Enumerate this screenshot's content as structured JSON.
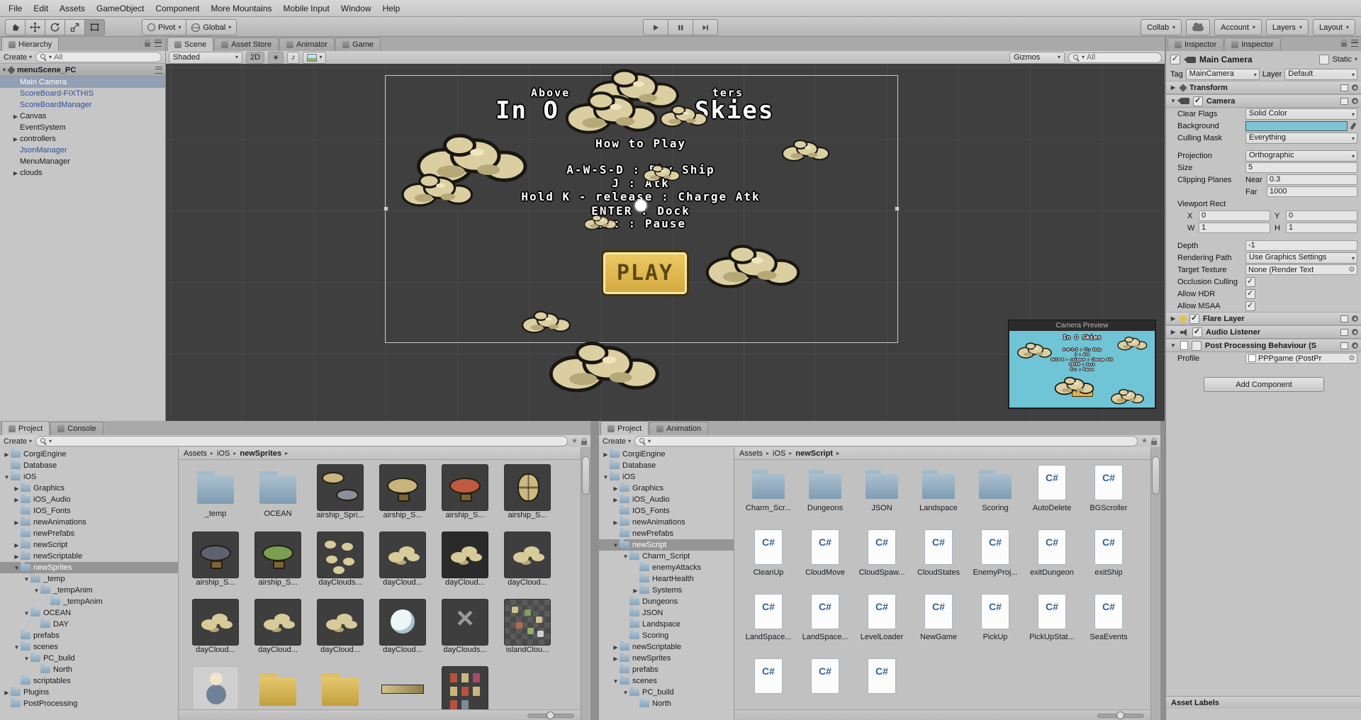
{
  "menu": {
    "items": [
      "File",
      "Edit",
      "Assets",
      "GameObject",
      "Component",
      "More Mountains",
      "Mobile Input",
      "Window",
      "Help"
    ]
  },
  "toolbar": {
    "pivot": "Pivot",
    "global": "Global",
    "collab": "Collab",
    "account": "Account",
    "layers": "Layers",
    "layout": "Layout"
  },
  "hierarchy": {
    "tab": "Hierarchy",
    "create_label": "Create",
    "search_filter": "All",
    "scene_name": "menuScene_PC",
    "items": [
      {
        "label": "Main Camera",
        "cls": "selected",
        "indent": 1
      },
      {
        "label": "ScoreBoard-FIXTHIS",
        "cls": "prefab",
        "indent": 1
      },
      {
        "label": "ScoreBoardManager",
        "cls": "prefab",
        "indent": 1
      },
      {
        "label": "Canvas",
        "arrow": "▶",
        "indent": 1
      },
      {
        "label": "EventSystem",
        "indent": 1
      },
      {
        "label": "controllers",
        "arrow": "▶",
        "indent": 1
      },
      {
        "label": "JsonManager",
        "cls": "prefab",
        "indent": 1
      },
      {
        "label": "MenuManager",
        "indent": 1
      },
      {
        "label": "clouds",
        "arrow": "▶",
        "indent": 1
      }
    ]
  },
  "scene": {
    "tabs": [
      "Scene",
      "Asset Store",
      "Animator",
      "Game"
    ],
    "shaded": "Shaded",
    "mode2d": "2D",
    "gizmos": "Gizmos",
    "search_filter": "All",
    "overlay": {
      "subtitle_left": "Above",
      "subtitle_right": "ters",
      "title_left": "In O",
      "title_right": "Skies",
      "howto": "How to Play",
      "line1": "A-W-S-D : Fly Ship",
      "line2": "J : Atk",
      "line3": "Hold K - release : Charge Atk",
      "line4": "ENTER : Dock",
      "line5": "Esc : Pause",
      "play_label": "PLAY"
    },
    "camera_preview_label": "Camera Preview"
  },
  "inspector": {
    "tabs": [
      "Inspector",
      "Inspector"
    ],
    "name": "Main Camera",
    "static_label": "Static",
    "tag_label": "Tag",
    "tag_value": "MainCamera",
    "layer_label": "Layer",
    "layer_value": "Default",
    "transform_title": "Transform",
    "camera_title": "Camera",
    "rows": {
      "clear_flags_label": "Clear Flags",
      "clear_flags": "Solid Color",
      "background_label": "Background",
      "culling_label": "Culling Mask",
      "culling": "Everything",
      "projection_label": "Projection",
      "projection": "Orthographic",
      "size_label": "Size",
      "size": "5",
      "clipping_label": "Clipping Planes",
      "near_label": "Near",
      "near": "0.3",
      "far_label": "Far",
      "far": "1000",
      "viewport_label": "Viewport Rect",
      "x_label": "X",
      "x": "0",
      "y_label": "Y",
      "y": "0",
      "w_label": "W",
      "w": "1",
      "h_label": "H",
      "h": "1",
      "depth_label": "Depth",
      "depth": "-1",
      "rendering_label": "Rendering Path",
      "rendering": "Use Graphics Settings",
      "target_label": "Target Texture",
      "target": "None (Render Text",
      "occlusion_label": "Occlusion Culling",
      "hdr_label": "Allow HDR",
      "msaa_label": "Allow MSAA"
    },
    "flare_title": "Flare Layer",
    "audio_title": "Audio Listener",
    "ppb_title": "Post Processing Behaviour (S",
    "profile_label": "Profile",
    "profile_value": "PPPgame (PostPr",
    "add_component": "Add Component",
    "asset_labels": "Asset Labels"
  },
  "project1": {
    "tabs": [
      "Project",
      "Console"
    ],
    "create_label": "Create",
    "breadcrumb": [
      "Assets",
      "iOS",
      "newSprites"
    ],
    "tree": [
      {
        "label": "CorgiEngine",
        "arrow": "▶",
        "indent": 0
      },
      {
        "label": "Database",
        "indent": 0
      },
      {
        "label": "iOS",
        "arrow": "▼",
        "indent": 0
      },
      {
        "label": "Graphics",
        "arrow": "▶",
        "indent": 1
      },
      {
        "label": "iOS_Audio",
        "arrow": "▶",
        "indent": 1
      },
      {
        "label": "IOS_Fonts",
        "indent": 1
      },
      {
        "label": "newAnimations",
        "arrow": "▶",
        "indent": 1
      },
      {
        "label": "newPrefabs",
        "indent": 1
      },
      {
        "label": "newScript",
        "arrow": "▶",
        "indent": 1
      },
      {
        "label": "newScriptable",
        "arrow": "▶",
        "indent": 1
      },
      {
        "label": "newSprites",
        "arrow": "▼",
        "indent": 1,
        "cls": "selected"
      },
      {
        "label": "_temp",
        "arrow": "▼",
        "indent": 2
      },
      {
        "label": "_tempAnim",
        "arrow": "▼",
        "indent": 3
      },
      {
        "label": "_tempAnim",
        "indent": 4
      },
      {
        "label": "OCEAN",
        "arrow": "▼",
        "indent": 2
      },
      {
        "label": "DAY",
        "indent": 3
      },
      {
        "label": "prefabs",
        "indent": 1
      },
      {
        "label": "scenes",
        "arrow": "▼",
        "indent": 1
      },
      {
        "label": "PC_build",
        "arrow": "▼",
        "indent": 2
      },
      {
        "label": "North",
        "indent": 3
      },
      {
        "label": "scriptables",
        "indent": 1
      },
      {
        "label": "Plugins",
        "arrow": "▶",
        "indent": 0
      },
      {
        "label": "PostProcessing",
        "indent": 0
      }
    ],
    "tiles": [
      {
        "label": "_temp",
        "kind": "folder"
      },
      {
        "label": "OCEAN",
        "kind": "folder"
      },
      {
        "label": "airship_Spri...",
        "kind": "ship-sheet"
      },
      {
        "label": "airship_S...",
        "kind": "ship"
      },
      {
        "label": "airship_S...",
        "kind": "ship-red"
      },
      {
        "label": "airship_S...",
        "kind": "bomb"
      },
      {
        "label": "airship_S...",
        "kind": "ship-dark"
      },
      {
        "label": "airship_S...",
        "kind": "ship-green"
      },
      {
        "label": "dayClouds...",
        "kind": "cloud-sheet"
      },
      {
        "label": "dayCloud...",
        "kind": "cloud"
      },
      {
        "label": "dayCloud...",
        "kind": "cloud-dark"
      },
      {
        "label": "dayCloud...",
        "kind": "cloud"
      },
      {
        "label": "dayCloud...",
        "kind": "cloud"
      },
      {
        "label": "dayCloud...",
        "kind": "cloud"
      },
      {
        "label": "dayCloud...",
        "kind": "cloud"
      },
      {
        "label": "dayCloud...",
        "kind": "moon"
      },
      {
        "label": "dayClouds...",
        "kind": "arrows"
      },
      {
        "label": "islandClou...",
        "kind": "island-sheet"
      },
      {
        "label": "",
        "kind": "person"
      },
      {
        "label": "",
        "kind": "folder-tan"
      },
      {
        "label": "",
        "kind": "folder-tan"
      },
      {
        "label": "",
        "kind": "strip"
      },
      {
        "label": "",
        "kind": "chars-sheet"
      }
    ]
  },
  "project2": {
    "tabs": [
      "Project",
      "Animation"
    ],
    "create_label": "Create",
    "breadcrumb": [
      "Assets",
      "iOS",
      "newScript"
    ],
    "tree": [
      {
        "label": "CorgiEngine",
        "arrow": "▶",
        "indent": 0
      },
      {
        "label": "Database",
        "indent": 0
      },
      {
        "label": "iOS",
        "arrow": "▼",
        "indent": 0
      },
      {
        "label": "Graphics",
        "arrow": "▶",
        "indent": 1
      },
      {
        "label": "iOS_Audio",
        "arrow": "▶",
        "indent": 1
      },
      {
        "label": "IOS_Fonts",
        "indent": 1
      },
      {
        "label": "newAnimations",
        "arrow": "▶",
        "indent": 1
      },
      {
        "label": "newPrefabs",
        "indent": 1
      },
      {
        "label": "newScript",
        "arrow": "▼",
        "indent": 1,
        "cls": "selected"
      },
      {
        "label": "Charm_Script",
        "arrow": "▼",
        "indent": 2
      },
      {
        "label": "enemyAttacks",
        "indent": 3
      },
      {
        "label": "HeartHealth",
        "indent": 3
      },
      {
        "label": "Systems",
        "arrow": "▶",
        "indent": 3
      },
      {
        "label": "Dungeons",
        "indent": 2
      },
      {
        "label": "JSON",
        "indent": 2
      },
      {
        "label": "Landspace",
        "indent": 2
      },
      {
        "label": "Scoring",
        "indent": 2
      },
      {
        "label": "newScriptable",
        "arrow": "▶",
        "indent": 1
      },
      {
        "label": "newSprites",
        "arrow": "▶",
        "indent": 1
      },
      {
        "label": "prefabs",
        "indent": 1
      },
      {
        "label": "scenes",
        "arrow": "▼",
        "indent": 1
      },
      {
        "label": "PC_build",
        "arrow": "▼",
        "indent": 2
      },
      {
        "label": "North",
        "indent": 3
      }
    ],
    "tiles": [
      {
        "label": "Charm_Scr...",
        "kind": "folder"
      },
      {
        "label": "Dungeons",
        "kind": "folder"
      },
      {
        "label": "JSON",
        "kind": "folder"
      },
      {
        "label": "Landspace",
        "kind": "folder"
      },
      {
        "label": "Scoring",
        "kind": "folder"
      },
      {
        "label": "AutoDelete",
        "kind": "cs"
      },
      {
        "label": "BGScroller",
        "kind": "cs"
      },
      {
        "label": "CleanUp",
        "kind": "cs"
      },
      {
        "label": "CloudMove",
        "kind": "cs"
      },
      {
        "label": "CloudSpaw...",
        "kind": "cs"
      },
      {
        "label": "CloudStates",
        "kind": "cs"
      },
      {
        "label": "EnemyProj...",
        "kind": "cs"
      },
      {
        "label": "exitDungeon",
        "kind": "cs"
      },
      {
        "label": "exitShip",
        "kind": "cs"
      },
      {
        "label": "LandSpace...",
        "kind": "cs"
      },
      {
        "label": "LandSpace...",
        "kind": "cs"
      },
      {
        "label": "LevelLoader",
        "kind": "cs"
      },
      {
        "label": "NewGame",
        "kind": "cs"
      },
      {
        "label": "PickUp",
        "kind": "cs"
      },
      {
        "label": "PickUpStat...",
        "kind": "cs"
      },
      {
        "label": "SeaEvents",
        "kind": "cs"
      },
      {
        "label": "",
        "kind": "cs"
      },
      {
        "label": "",
        "kind": "cs"
      },
      {
        "label": "",
        "kind": "cs"
      }
    ]
  },
  "colors": {
    "camera_background": "#7ec6d6",
    "preview_sky": "#6fc5d6"
  }
}
